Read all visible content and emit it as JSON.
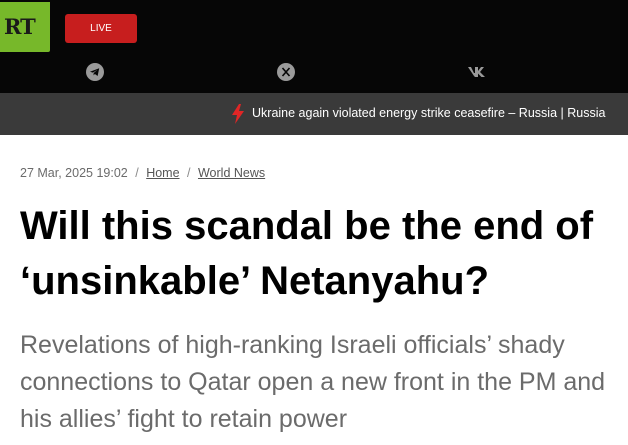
{
  "header": {
    "logo_text": "RT",
    "live_label": "LIVE",
    "social": [
      "telegram-icon",
      "x-icon",
      "vk-icon"
    ]
  },
  "ticker": {
    "text": "Ukraine again violated energy strike ceasefire – Russia | Russia"
  },
  "article": {
    "date": "27 Mar, 2025 19:02",
    "breadcrumbs": [
      "Home",
      "World News"
    ],
    "headline": "Will this scandal be the end of ‘unsinkable’ Netanyahu?",
    "subtitle": "Revelations of high-ranking Israeli officials’ shady connections to Qatar open a new front in the PM and his allies’ fight to retain power"
  },
  "colors": {
    "topbar": "#060606",
    "logo": "#77b82a",
    "live": "#c71e1e",
    "ticker": "#3a3a3a",
    "bolt": "#e02626"
  }
}
